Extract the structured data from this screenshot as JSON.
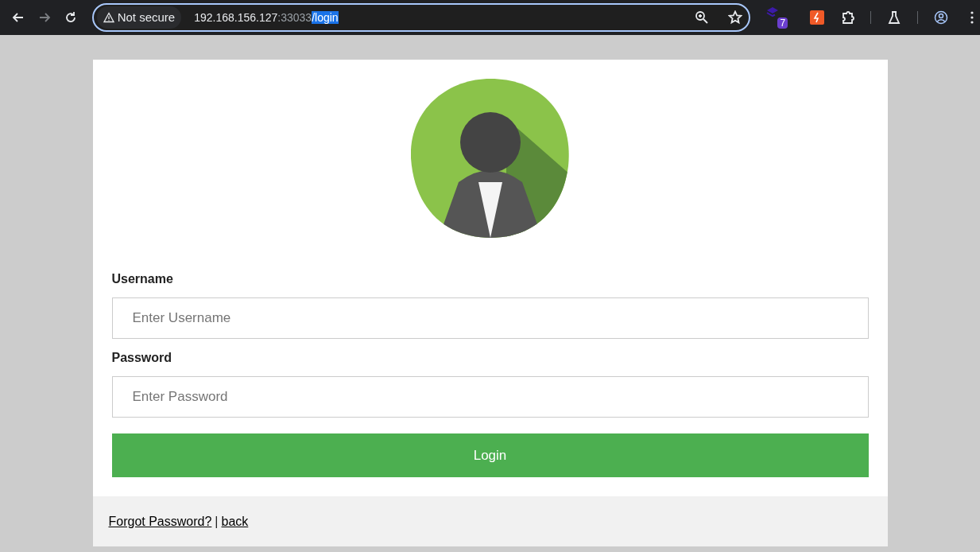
{
  "browser": {
    "security": "Not secure",
    "url": {
      "host": "192.168.156.127",
      "port": ":33033",
      "path": "/login",
      "path_selected": true
    },
    "extension_badge": "7"
  },
  "login_form": {
    "fields": [
      {
        "label": "Username",
        "placeholder": "Enter Username"
      },
      {
        "label": "Password",
        "placeholder": "Enter Password"
      }
    ],
    "submit": "Login"
  },
  "footer": {
    "forgot_link": "Forgot Password?",
    "separator": "|",
    "back_link": "back"
  }
}
